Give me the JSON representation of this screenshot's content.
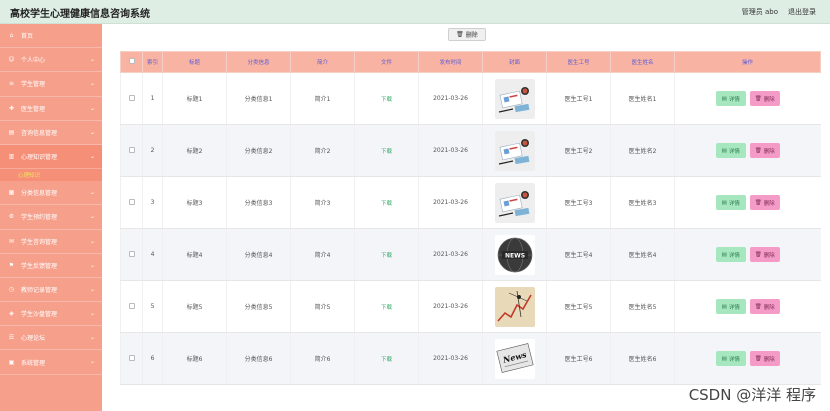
{
  "app": {
    "title": "高校学生心理健康信息咨询系统",
    "admin_label": "管理员 abo",
    "logout_label": "退出登录"
  },
  "sidebar": {
    "items": [
      {
        "label": "首页",
        "icon": "home-icon",
        "chevron": false
      },
      {
        "label": "个人中心",
        "icon": "user-icon",
        "chevron": true
      },
      {
        "label": "学生管理",
        "icon": "list-icon",
        "chevron": true
      },
      {
        "label": "医生管理",
        "icon": "doctor-icon",
        "chevron": true
      },
      {
        "label": "咨询信息管理",
        "icon": "doc-icon",
        "chevron": true
      },
      {
        "label": "心理知识管理",
        "icon": "chart-icon",
        "chevron": true,
        "active": true
      },
      {
        "label": "分类信息管理",
        "icon": "grid-icon",
        "chevron": true
      },
      {
        "label": "学生预约管理",
        "icon": "gear-icon",
        "chevron": true
      },
      {
        "label": "学生咨询管理",
        "icon": "chat-icon",
        "chevron": true
      },
      {
        "label": "学生反馈管理",
        "icon": "flag-icon",
        "chevron": true
      },
      {
        "label": "教师记录管理",
        "icon": "clock-icon",
        "chevron": true
      },
      {
        "label": "学生沙盘管理",
        "icon": "shield-icon",
        "chevron": true
      },
      {
        "label": "心理论坛",
        "icon": "forum-icon",
        "chevron": true
      },
      {
        "label": "系统管理",
        "icon": "system-icon",
        "chevron": true
      }
    ],
    "sub_item": "心理知识"
  },
  "toolbar": {
    "delete_label": "删除"
  },
  "table": {
    "headers": [
      "索引",
      "标题",
      "分类信息",
      "简介",
      "文件",
      "发布时间",
      "封面",
      "医生工号",
      "医生姓名",
      "操作"
    ],
    "rows": [
      {
        "index": "1",
        "title": "标题1",
        "category": "分类信息1",
        "intro": "简介1",
        "file": "下载",
        "date": "2021-03-26",
        "cover": "workspace",
        "doc_id": "医生工号1",
        "doc_name": "医生姓名1"
      },
      {
        "index": "2",
        "title": "标题2",
        "category": "分类信息2",
        "intro": "简介2",
        "file": "下载",
        "date": "2021-03-26",
        "cover": "workspace",
        "doc_id": "医生工号2",
        "doc_name": "医生姓名2"
      },
      {
        "index": "3",
        "title": "标题3",
        "category": "分类信息3",
        "intro": "简介3",
        "file": "下载",
        "date": "2021-03-26",
        "cover": "workspace",
        "doc_id": "医生工号3",
        "doc_name": "医生姓名3"
      },
      {
        "index": "4",
        "title": "标题4",
        "category": "分类信息4",
        "intro": "简介4",
        "file": "下载",
        "date": "2021-03-26",
        "cover": "news-globe",
        "doc_id": "医生工号4",
        "doc_name": "医生姓名4"
      },
      {
        "index": "5",
        "title": "标题5",
        "category": "分类信息5",
        "intro": "简介5",
        "file": "下载",
        "date": "2021-03-26",
        "cover": "chart-arrow",
        "doc_id": "医生工号5",
        "doc_name": "医生姓名5"
      },
      {
        "index": "6",
        "title": "标题6",
        "category": "分类信息6",
        "intro": "简介6",
        "file": "下载",
        "date": "2021-03-26",
        "cover": "news-paper",
        "doc_id": "医生工号6",
        "doc_name": "医生姓名6"
      }
    ],
    "detail_label": "详情",
    "delete_label": "删除"
  },
  "watermark": "CSDN @洋洋 程序",
  "colors": {
    "sidebar": "#f6a08c",
    "header_row": "#f8b3a2",
    "detail_btn": "#a6e7c0",
    "delete_btn": "#f59bc7",
    "topbar": "#dfeee4"
  }
}
